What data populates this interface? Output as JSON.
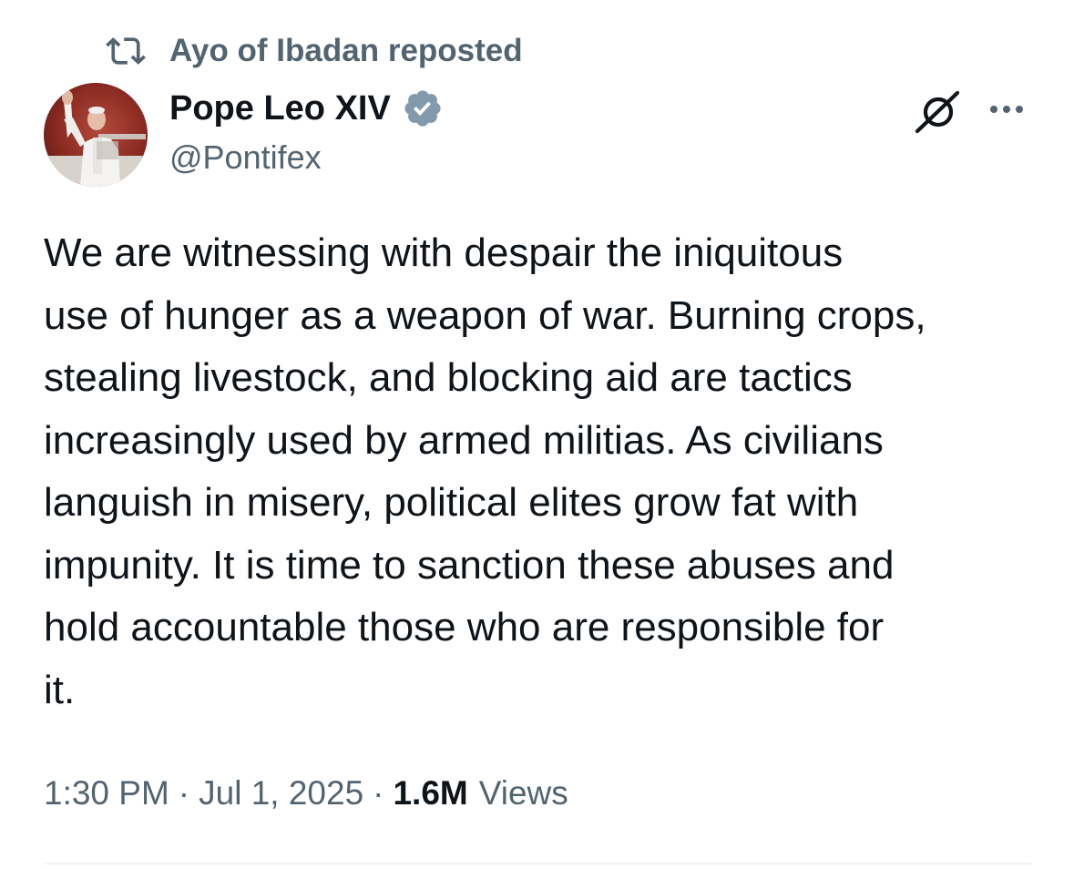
{
  "repost": {
    "label": "Ayo of Ibadan reposted",
    "icon": "repost-icon"
  },
  "author": {
    "display_name": "Pope Leo XIV",
    "handle": "@Pontifex",
    "verified_icon": "verified-badge-icon",
    "verified_color": "#829aab",
    "avatar_icon": "avatar"
  },
  "actions": {
    "grok_icon": "grok-icon",
    "more_icon": "more-icon"
  },
  "tweet": {
    "lines": [
      "We are witnessing with despair the iniquitous",
      "use of hunger as a weapon of war. Burning crops,",
      "stealing livestock, and blocking aid are tactics",
      "increasingly used by armed militias. As civilians",
      "languish in misery, political elites grow fat with",
      "impunity. It is time to sanction these abuses and",
      "hold accountable those who are responsible for",
      "it."
    ]
  },
  "meta": {
    "time": "1:30 PM",
    "separator": "·",
    "date": "Jul 1, 2025",
    "views_count": "1.6M",
    "views_label": "Views"
  },
  "colors": {
    "text_primary": "#0f1419",
    "text_secondary": "#536471",
    "divider": "#eff3f4"
  }
}
